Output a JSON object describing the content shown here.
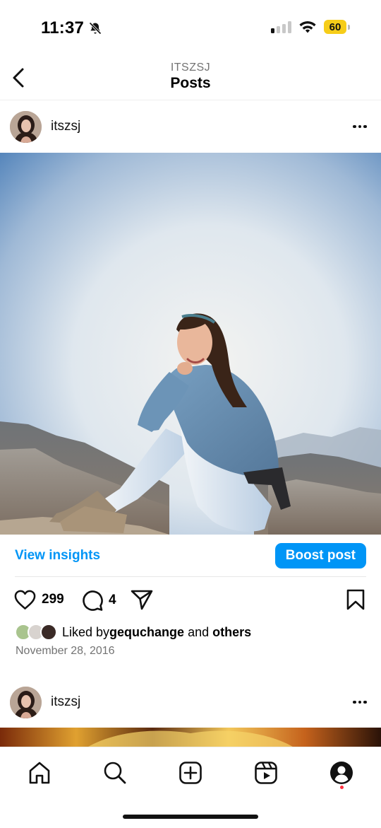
{
  "status_bar": {
    "time": "11:37",
    "battery": "60",
    "icons": [
      "bell-slash-icon",
      "signal-icon",
      "wifi-icon",
      "battery-icon"
    ]
  },
  "header": {
    "username_caps": "ITSZSJ",
    "title": "Posts"
  },
  "post": {
    "username": "itszsj",
    "insights_label": "View insights",
    "boost_label": "Boost post",
    "likes": "299",
    "comments": "4",
    "liked_prefix": "Liked by ",
    "liked_user": "gequchange",
    "liked_and": " and ",
    "liked_others": "others",
    "date": "November 28, 2016"
  },
  "next_post": {
    "username": "itszsj"
  },
  "bottom_nav": {
    "items": [
      "home-icon",
      "search-icon",
      "create-icon",
      "reels-icon",
      "profile-icon"
    ]
  },
  "colors": {
    "accent": "#0095f6",
    "battery": "#f6cd19",
    "notification": "#ff3040"
  }
}
